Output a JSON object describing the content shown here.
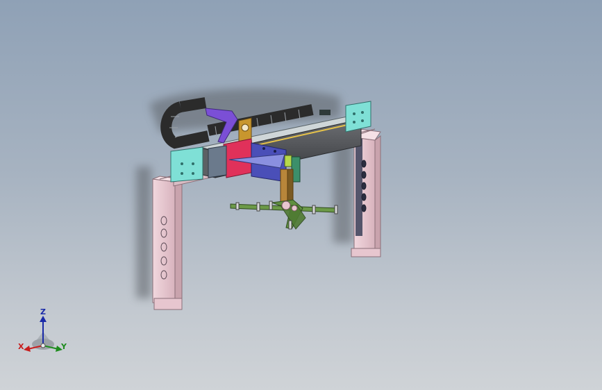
{
  "viewport": {
    "background_top": "#8fa1b6",
    "background_bottom": "#cfd3d7"
  },
  "model": {
    "colors": {
      "legs": "#e7c6cf",
      "beam": "#b9c7c9",
      "beam_face": "#9fb3b6",
      "end_plates": "#7fe0d6",
      "cable_chain": "#2b2b2b",
      "carriage": "#e0315a",
      "bracket_blue": "#4a4fb8",
      "bracket_purple": "#7b4fd6",
      "arm_gold": "#c8962e",
      "gripper_green": "#5f8f3e",
      "leg_holes": "#3a3f58",
      "shadow": "#6e7479"
    }
  },
  "triad": {
    "axes": [
      {
        "label": "Z",
        "color": "#1a2aa8",
        "icon": "arrow-up-icon"
      },
      {
        "label": "X",
        "color": "#c81e1e",
        "icon": "arrow-left-icon"
      },
      {
        "label": "Y",
        "color": "#1e8c1e",
        "icon": "arrow-right-icon"
      }
    ]
  }
}
